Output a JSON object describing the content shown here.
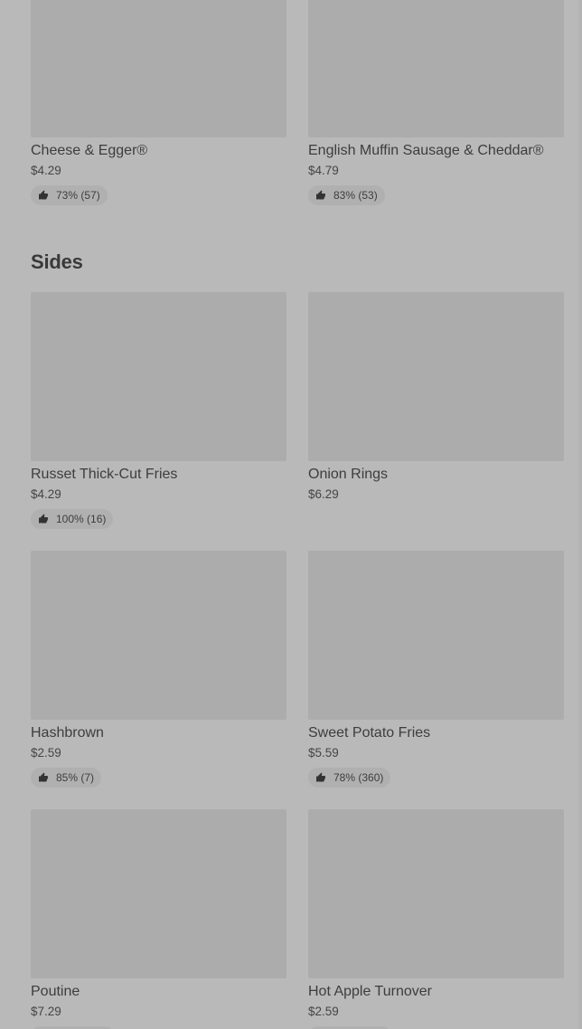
{
  "breakfast": {
    "items": [
      {
        "name": "Cheese & Egger®",
        "price": "$4.29",
        "rating": "73% (57)"
      },
      {
        "name": "English Muffin Sausage & Cheddar®",
        "price": "$4.79",
        "rating": "83% (53)"
      }
    ]
  },
  "sides": {
    "title": "Sides",
    "items": [
      {
        "name": "Russet Thick-Cut Fries",
        "price": "$4.29",
        "rating": "100% (16)"
      },
      {
        "name": "Onion Rings",
        "price": "$6.29",
        "rating": ""
      },
      {
        "name": "Hashbrown",
        "price": "$2.59",
        "rating": "85% (7)"
      },
      {
        "name": "Sweet Potato Fries",
        "price": "$5.59",
        "rating": "78% (360)"
      },
      {
        "name": "Poutine",
        "price": "$7.29",
        "rating": ""
      },
      {
        "name": "Hot Apple Turnover",
        "price": "$2.59",
        "rating": ""
      }
    ]
  },
  "icons": {
    "rating": "thumbs-up-icon"
  }
}
